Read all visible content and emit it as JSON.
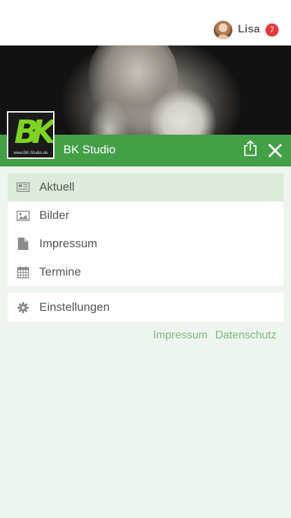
{
  "topbar": {
    "username": "Lisa",
    "notification_count": "7"
  },
  "header": {
    "studio_name": "BK Studio",
    "logo_mark": "BK",
    "logo_caption": "www.BK-Studio.de"
  },
  "icons": {
    "share": "share-icon",
    "close": "close-icon",
    "aktuell": "newspaper-icon",
    "bilder": "image-icon",
    "impressum": "document-icon",
    "termine": "calendar-icon",
    "einstellungen": "gear-icon"
  },
  "menu": {
    "items": [
      {
        "label": "Aktuell",
        "active": true
      },
      {
        "label": "Bilder"
      },
      {
        "label": "Impressum"
      },
      {
        "label": "Termine"
      }
    ],
    "settings_label": "Einstellungen"
  },
  "footer_links": {
    "impressum": "Impressum",
    "datenschutz": "Datenschutz"
  },
  "colors": {
    "accent": "#43a047",
    "active_bg": "#dcebdc",
    "page_bg": "#eef5ee",
    "link": "#7cb87e",
    "badge": "#e53935"
  }
}
